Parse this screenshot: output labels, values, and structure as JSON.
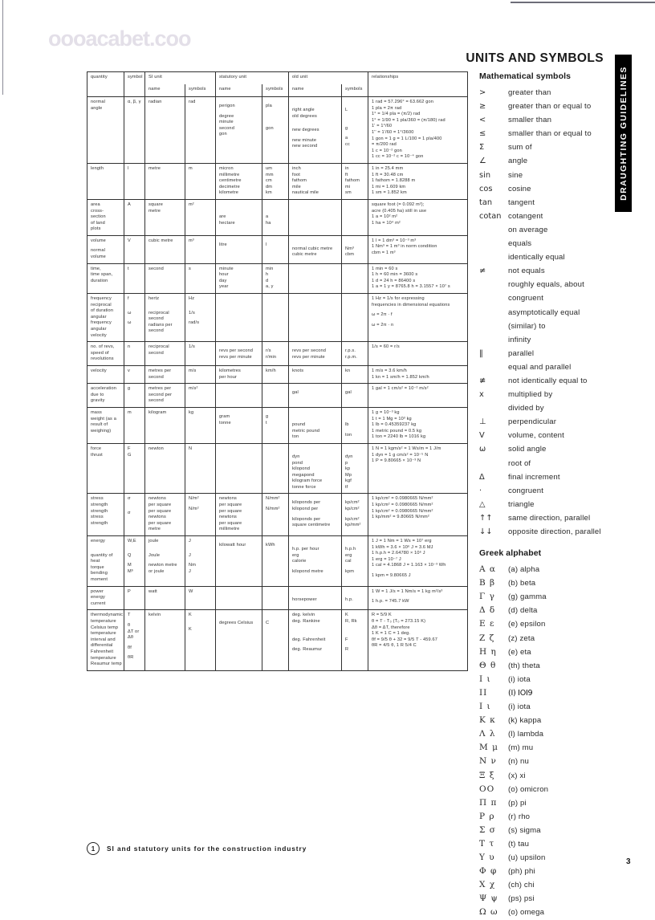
{
  "document": {
    "heading": "UNITS AND SYMBOLS",
    "side_tab": "DRAUGHTING GUIDELINES",
    "watermark": "oooacabet.coo",
    "page_number": "3",
    "caption_number": "1",
    "caption_text": "SI and statutory units for the construction industry"
  },
  "reference": {
    "math_title": "Mathematical symbols",
    "greek_title": "Greek alphabet",
    "math_symbols": [
      {
        "symbol": ">",
        "desc": "greater than"
      },
      {
        "symbol": "≥",
        "desc": "greater than or equal to"
      },
      {
        "symbol": "<",
        "desc": "smaller than"
      },
      {
        "symbol": "≤",
        "desc": "smaller than or equal to"
      },
      {
        "symbol": "Σ",
        "desc": "sum of"
      },
      {
        "symbol": "∠",
        "desc": "angle"
      },
      {
        "symbol": "sin",
        "desc": "sine"
      },
      {
        "symbol": "cos",
        "desc": "cosine"
      },
      {
        "symbol": "tan",
        "desc": "tangent"
      },
      {
        "symbol": "cotan",
        "desc": "cotangent"
      },
      {
        "symbol": "",
        "desc": "on average"
      },
      {
        "symbol": "",
        "desc": "equals"
      },
      {
        "symbol": "",
        "desc": "identically equal"
      },
      {
        "symbol": "≠",
        "desc": "not equals"
      },
      {
        "symbol": "",
        "desc": "roughly equals, about"
      },
      {
        "symbol": "",
        "desc": "congruent"
      },
      {
        "symbol": "",
        "desc": "asymptotically equal"
      },
      {
        "symbol": "",
        "desc": "(similar) to"
      },
      {
        "symbol": "",
        "desc": "infinity"
      },
      {
        "symbol": "‖",
        "desc": "parallel"
      },
      {
        "symbol": "",
        "desc": "equal and parallel"
      },
      {
        "symbol": "≢",
        "desc": "not identically equal to"
      },
      {
        "symbol": "x",
        "desc": "multiplied by"
      },
      {
        "symbol": "",
        "desc": "divided by"
      },
      {
        "symbol": "⊥",
        "desc": "perpendicular"
      },
      {
        "symbol": "V",
        "desc": "volume, content"
      },
      {
        "symbol": "ω",
        "desc": "solid angle"
      },
      {
        "symbol": "",
        "desc": "root of"
      },
      {
        "symbol": "Δ",
        "desc": "final increment"
      },
      {
        "symbol": "·",
        "desc": "congruent"
      },
      {
        "symbol": "△",
        "desc": "triangle"
      },
      {
        "symbol": "↑↑",
        "desc": "same direction, parallel"
      },
      {
        "symbol": "↓↓",
        "desc": "opposite direction, parallel"
      }
    ],
    "greek_alphabet": [
      {
        "symbol": "Α α",
        "desc": "(a) alpha"
      },
      {
        "symbol": "Β β",
        "desc": "(b) beta"
      },
      {
        "symbol": "Γ γ",
        "desc": "(g) gamma"
      },
      {
        "symbol": "Δ δ",
        "desc": "(d) delta"
      },
      {
        "symbol": "Ε ε",
        "desc": "(e) epsilon"
      },
      {
        "symbol": "Ζ ζ",
        "desc": "(z) zeta"
      },
      {
        "symbol": "Η η",
        "desc": "(e) eta"
      },
      {
        "symbol": "Θ θ",
        "desc": "(th) theta"
      },
      {
        "symbol": "Ι ι",
        "desc": "(i) iota"
      },
      {
        "symbol": "ΙΙ",
        "desc": "(I) IOI9"
      },
      {
        "symbol": "Ι ι",
        "desc": "(i) iota"
      },
      {
        "symbol": "Κ κ",
        "desc": "(k) kappa"
      },
      {
        "symbol": "Λ λ",
        "desc": "(l) lambda"
      },
      {
        "symbol": "Μ μ",
        "desc": "(m) mu"
      },
      {
        "symbol": "Ν ν",
        "desc": "(n) nu"
      },
      {
        "symbol": "Ξ ξ",
        "desc": "(x) xi"
      },
      {
        "symbol": "ΟΟ",
        "desc": "(o) omicron"
      },
      {
        "symbol": "Π π",
        "desc": "(p) pi"
      },
      {
        "symbol": "Ρ ρ",
        "desc": "(r) rho"
      },
      {
        "symbol": "Σ σ",
        "desc": "(s) sigma"
      },
      {
        "symbol": "Τ τ",
        "desc": "(t) tau"
      },
      {
        "symbol": "Υ υ",
        "desc": "(u) upsilon"
      },
      {
        "symbol": "Φ φ",
        "desc": "(ph) phi"
      },
      {
        "symbol": "Χ χ",
        "desc": "(ch) chi"
      },
      {
        "symbol": "Ψ ψ",
        "desc": "(ps) psi"
      },
      {
        "symbol": "Ω ω",
        "desc": "(o) omega"
      }
    ]
  },
  "table": {
    "headers": {
      "quantity": "quantity",
      "symbol": "symbol",
      "si_unit": "SI unit",
      "statutory_unit": "statutory unit",
      "old_unit": "old unit",
      "relationships": "relationships",
      "name": "name",
      "symbols": "symbols"
    },
    "rows": [
      {
        "quantity": [
          "normal",
          "angle"
        ],
        "symbol": [
          "α, β, γ"
        ],
        "si_name": [
          "radian"
        ],
        "si_symbols": [
          "rad"
        ],
        "stat_name": [
          "",
          "perigon",
          "",
          "degree",
          "minute",
          "second",
          "gon"
        ],
        "stat_symbols": [
          "",
          "pla",
          "",
          "",
          "",
          "",
          "gon"
        ],
        "old_name": [
          "",
          "",
          "right angle",
          "old degrees",
          "",
          "",
          "new degrees",
          "",
          "new minute",
          "new second"
        ],
        "old_symbols": [
          "",
          "",
          "L",
          "",
          "",
          "",
          "g",
          "",
          "a",
          "cc"
        ],
        "relationships": [
          "1 rad = 57.296° = 63.662 gon",
          "1 pla = 2π rad",
          "1° = 1/4 pla = (π/2) rad",
          "1° = 1/90 = 1 pla/360 = (π/180) rad",
          "1' = 1°/60",
          "1'' = 1'/60 = 1°/3600",
          "1 gon = 1 g = 1 L/100 = 1 pla/400",
          "= π/200 rad",
          "1 c = 10⁻² gon",
          "1 cc = 10⁻² c = 10⁻⁴ gon"
        ]
      },
      {
        "quantity": [
          "length"
        ],
        "symbol": [
          "l"
        ],
        "si_name": [
          "metre"
        ],
        "si_symbols": [
          "m"
        ],
        "stat_name": [
          "micron",
          "millimetre",
          "centimetre",
          "decimetre",
          "kilometre"
        ],
        "stat_symbols": [
          "um",
          "mm",
          "cm",
          "dm",
          "km"
        ],
        "old_name": [
          "inch",
          "foot",
          "fathom",
          "mile",
          "nautical mile"
        ],
        "old_symbols": [
          "in",
          "ft",
          "fathom",
          "mi",
          "sm"
        ],
        "relationships": [
          "1 in = 25.4 mm",
          "1 ft = 30.48 cm",
          "1 fathom = 1.8288 m",
          "1 mi = 1.609 km",
          "1 sm = 1.852 km"
        ]
      },
      {
        "quantity": [
          "area",
          "cross-",
          "section",
          "of land",
          "plots"
        ],
        "symbol": [
          "A"
        ],
        "si_name": [
          "square",
          "metre"
        ],
        "si_symbols": [
          "m²"
        ],
        "stat_name": [
          "",
          "",
          "",
          "are",
          "hectare"
        ],
        "stat_symbols": [
          "",
          "",
          "",
          "a",
          "ha"
        ],
        "old_name": [],
        "old_symbols": [],
        "relationships": [
          "square foot (= 0.092 m²);",
          "acre (0.405 ha) still in use",
          "1 a = 10² m²",
          "1 ha = 10⁴ m²"
        ]
      },
      {
        "quantity": [
          "volume",
          "",
          "normal",
          "volume"
        ],
        "symbol": [
          "V"
        ],
        "si_name": [
          "cubic metre"
        ],
        "si_symbols": [
          "m³"
        ],
        "stat_name": [
          "",
          "litre"
        ],
        "stat_symbols": [
          "",
          "l"
        ],
        "old_name": [
          "",
          "",
          "normal cubic metre",
          "cubic metre"
        ],
        "old_symbols": [
          "",
          "",
          "Nm³",
          "cbm"
        ],
        "relationships": [
          "1 l = 1 dm³ = 10⁻³ m³",
          "1 Nm³ = 1 m³ in norm condition",
          "cbm = 1 m³"
        ]
      },
      {
        "quantity": [
          "time,",
          "time span,",
          "duration"
        ],
        "symbol": [
          "t"
        ],
        "si_name": [
          "second"
        ],
        "si_symbols": [
          "s"
        ],
        "stat_name": [
          "minute",
          "hour",
          "day",
          "year"
        ],
        "stat_symbols": [
          "min",
          "h",
          "d",
          "a, y"
        ],
        "old_name": [],
        "old_symbols": [],
        "relationships": [
          "1 min = 60 s",
          "1 h = 60 min = 3600 s",
          "1 d = 24 h = 86400 s",
          "1 a = 1 y = 8765.8 h = 3.1557 × 10⁷ s"
        ]
      },
      {
        "quantity": [
          "frequency",
          "reciprocal",
          "of duration",
          "angular",
          "frequency",
          "angular",
          "velocity"
        ],
        "symbol": [
          "f",
          "",
          "",
          "ω",
          "",
          "ω"
        ],
        "si_name": [
          "hertz",
          "",
          "",
          "reciprocal",
          "second",
          "radians per",
          "second"
        ],
        "si_symbols": [
          "Hz",
          "",
          "",
          "1/s",
          "",
          "rad/s"
        ],
        "stat_name": [],
        "stat_symbols": [],
        "old_name": [],
        "old_symbols": [],
        "relationships": [
          "1 Hz = 1/s for expressing",
          "frequencies in dimensional equations",
          "",
          "ω = 2π · f",
          "",
          "ω = 2π · n"
        ]
      },
      {
        "quantity": [
          "no. of revs,",
          "speed of",
          "revolutions"
        ],
        "symbol": [
          "n"
        ],
        "si_name": [
          "reciprocal",
          "second"
        ],
        "si_symbols": [
          "1/s"
        ],
        "stat_name": [
          "",
          "revs per second",
          "revs per minute"
        ],
        "stat_symbols": [
          "",
          "r/s",
          "r/min"
        ],
        "old_name": [
          "",
          "revs per second",
          "revs per minute"
        ],
        "old_symbols": [
          "",
          "r.p.s.",
          "r.p.m."
        ],
        "relationships": [
          "1/s = 60 = r/s"
        ]
      },
      {
        "quantity": [
          "velocity"
        ],
        "symbol": [
          "v"
        ],
        "si_name": [
          "metres per",
          "second"
        ],
        "si_symbols": [
          "m/s"
        ],
        "stat_name": [
          "kilometres",
          "per hour"
        ],
        "stat_symbols": [
          "km/h"
        ],
        "old_name": [
          "knots",
          ""
        ],
        "old_symbols": [
          "kn"
        ],
        "relationships": [
          "1 m/s = 3.6 km/h",
          "1 kn = 1 sm/h = 1.852 km/h"
        ]
      },
      {
        "quantity": [
          "acceleration",
          "due to",
          "gravity"
        ],
        "symbol": [
          "g"
        ],
        "si_name": [
          "metres per",
          "second per",
          "second"
        ],
        "si_symbols": [
          "m/s²"
        ],
        "stat_name": [],
        "stat_symbols": [],
        "old_name": [
          "",
          "gal"
        ],
        "old_symbols": [
          "",
          "gal"
        ],
        "relationships": [
          "1 gal = 1 cm/s² = 10⁻² m/s²"
        ]
      },
      {
        "quantity": [
          "mass",
          "weight (as a",
          "result of",
          "weighing)"
        ],
        "symbol": [
          "m"
        ],
        "si_name": [
          "kilogram"
        ],
        "si_symbols": [
          "kg"
        ],
        "stat_name": [
          "",
          "gram",
          "tonne"
        ],
        "stat_symbols": [
          "",
          "g",
          "t"
        ],
        "old_name": [
          "",
          "",
          "",
          "pound",
          "metric pound",
          "ton"
        ],
        "old_symbols": [
          "",
          "",
          "",
          "lb",
          "",
          "ton"
        ],
        "relationships": [
          "1 g = 10⁻³ kg",
          "1 t = 1 Mg = 10³ kg",
          "1 lb = 0.45359237 kg",
          "1 metric pound = 0.5 kg",
          "1 ton = 2240 lb = 1016 kg"
        ]
      },
      {
        "quantity": [
          "force",
          "thrust"
        ],
        "symbol": [
          "F",
          "G"
        ],
        "si_name": [
          "newton"
        ],
        "si_symbols": [
          "N"
        ],
        "stat_name": [],
        "stat_symbols": [],
        "old_name": [
          "",
          "",
          "dyn",
          "pond",
          "kilopond",
          "megapond",
          "kilogram force",
          "tonne force"
        ],
        "old_symbols": [
          "",
          "",
          "dyn",
          "p",
          "kp",
          "Mp",
          "kgf",
          "tf"
        ],
        "relationships": [
          "1 N = 1 kgm/s² = 1 Ws/m = 1 J/m",
          "1 dyn = 1 g cm/s² = 10⁻⁵ N",
          "1 P = 9.80665 × 10⁻³ N"
        ]
      },
      {
        "quantity": [
          "stress",
          "strength",
          "strength",
          "stress",
          "strength"
        ],
        "symbol": [
          "σ",
          "",
          "",
          "σ"
        ],
        "si_name": [
          "newtons",
          "per square",
          "per square",
          "newtons",
          "per square",
          "metre"
        ],
        "si_symbols": [
          "N/m²",
          "",
          "N/m²"
        ],
        "stat_name": [
          "newtons",
          "per square",
          "per square",
          "newtons",
          "per square",
          "millimetre"
        ],
        "stat_symbols": [
          "N/mm²",
          "",
          "N/mm²"
        ],
        "old_name": [
          "",
          "kiloponds per",
          "kilopond per",
          "",
          "kiloponds per",
          "square centimetre"
        ],
        "old_symbols": [
          "",
          "kp/cm²",
          "kp/cm²",
          "",
          "kp/cm²",
          "kp/mm²"
        ],
        "relationships": [
          "1 kp/cm² = 0.0980665 N/mm²",
          "1 kp/cm² = 0.0980665 N/mm²",
          "1 kp/cm² = 0.0980665 N/mm²",
          "1 kp/mm² = 9.80665 N/mm²"
        ]
      },
      {
        "quantity": [
          "energy",
          "",
          "",
          "quantity of",
          "heat",
          "torque",
          "bending",
          "moment"
        ],
        "symbol": [
          "W,E",
          "",
          "",
          "Q",
          "",
          "M",
          "Mᵇ"
        ],
        "si_name": [
          "joule",
          "",
          "",
          "Joule",
          "",
          "newton metre",
          "or joule"
        ],
        "si_symbols": [
          "J",
          "",
          "",
          "J",
          "",
          "Nm",
          "J"
        ],
        "stat_name": [
          "",
          "kilowatt hour"
        ],
        "stat_symbols": [
          "",
          "kWh"
        ],
        "old_name": [
          "",
          "",
          "h.p. per hour",
          "erg",
          "calorie",
          "",
          "kilopond metre"
        ],
        "old_symbols": [
          "",
          "",
          "h.p.h",
          "erg",
          "cal",
          "",
          "kpm"
        ],
        "relationships": [
          "1 J = 1 Nm = 1 Ws = 10⁷ erg",
          "1 kWh = 3.6 × 10⁶ J = 3.6 MJ",
          "1 h.p.h = 2.64780 × 10⁶ J",
          "1 erg = 10⁻⁷ J",
          "1 cal = 4.1868 J = 1.163 × 10⁻³ Wh",
          "",
          "1 kpm = 9.80665 J"
        ]
      },
      {
        "quantity": [
          "power",
          "energy",
          "current"
        ],
        "symbol": [
          "P"
        ],
        "si_name": [
          "watt"
        ],
        "si_symbols": [
          "W"
        ],
        "stat_name": [],
        "stat_symbols": [],
        "old_name": [
          "",
          "",
          "horsepower"
        ],
        "old_symbols": [
          "",
          "",
          "h.p."
        ],
        "relationships": [
          "1 W = 1 J/s = 1 Nm/s = 1 kg m²/s³",
          "",
          "1 h.p. = 745.7 kW"
        ]
      },
      {
        "quantity": [
          "thermodynamic",
          "temperature",
          "Celsius temp",
          "temperature",
          "interval and",
          "differential",
          "Fahrenheit",
          "temperature",
          "Reaumur temp"
        ],
        "symbol": [
          "T",
          "",
          "θ",
          "ΔT or",
          "Δθ",
          "",
          "θf",
          "",
          "θR"
        ],
        "si_name": [
          "kelvin"
        ],
        "si_symbols": [
          "K",
          "",
          "",
          "K"
        ],
        "stat_name": [
          "",
          "",
          "degrees Celsius"
        ],
        "stat_symbols": [
          "",
          "",
          "C"
        ],
        "old_name": [
          "deg. kelvin",
          "deg. Rankine",
          "",
          "",
          "",
          "deg. Fahrenheit",
          "",
          "deg. Reaumur"
        ],
        "old_symbols": [
          "K",
          "R, Rk",
          "",
          "",
          "",
          "F",
          "",
          "R"
        ],
        "relationships": [
          "R = 5/9 K",
          "θ = T - T₀ (T₀ = 273.15 K)",
          "Δθ = ΔT, therefore",
          "1 K = 1 C = 1 deg.",
          "θf = 9/5 θ + 32 = 9/5 T - 459.67",
          "θR = 4/5 θ, 1 R 5/4 C"
        ]
      }
    ]
  }
}
